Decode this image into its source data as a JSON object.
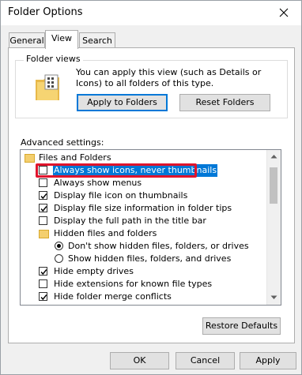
{
  "window": {
    "title": "Folder Options",
    "close_icon": "close-icon"
  },
  "tabs": [
    {
      "label": "General",
      "active": false
    },
    {
      "label": "View",
      "active": true
    },
    {
      "label": "Search",
      "active": false
    }
  ],
  "folder_views": {
    "group_label": "Folder views",
    "description": "You can apply this view (such as Details or Icons) to all folders of this type.",
    "icon": "folder-views-icon",
    "apply_button": "Apply to Folders",
    "reset_button": "Reset Folders"
  },
  "advanced": {
    "label": "Advanced settings:",
    "items": [
      {
        "kind": "folder",
        "label": "Files and Folders",
        "indent": 0
      },
      {
        "kind": "checkbox",
        "label": "Always show icons, never thumbnails",
        "checked": false,
        "selected": true,
        "indent": 1
      },
      {
        "kind": "checkbox",
        "label": "Always show menus",
        "checked": false,
        "indent": 1
      },
      {
        "kind": "checkbox",
        "label": "Display file icon on thumbnails",
        "checked": true,
        "indent": 1
      },
      {
        "kind": "checkbox",
        "label": "Display file size information in folder tips",
        "checked": true,
        "indent": 1
      },
      {
        "kind": "checkbox",
        "label": "Display the full path in the title bar",
        "checked": false,
        "indent": 1
      },
      {
        "kind": "folder",
        "label": "Hidden files and folders",
        "indent": 1
      },
      {
        "kind": "radio",
        "label": "Don't show hidden files, folders, or drives",
        "checked": true,
        "indent": 2
      },
      {
        "kind": "radio",
        "label": "Show hidden files, folders, and drives",
        "checked": false,
        "indent": 2
      },
      {
        "kind": "checkbox",
        "label": "Hide empty drives",
        "checked": true,
        "indent": 1
      },
      {
        "kind": "checkbox",
        "label": "Hide extensions for known file types",
        "checked": false,
        "indent": 1
      },
      {
        "kind": "checkbox",
        "label": "Hide folder merge conflicts",
        "checked": true,
        "indent": 1
      }
    ],
    "restore_button": "Restore Defaults"
  },
  "footer": {
    "ok": "OK",
    "cancel": "Cancel",
    "apply": "Apply"
  }
}
